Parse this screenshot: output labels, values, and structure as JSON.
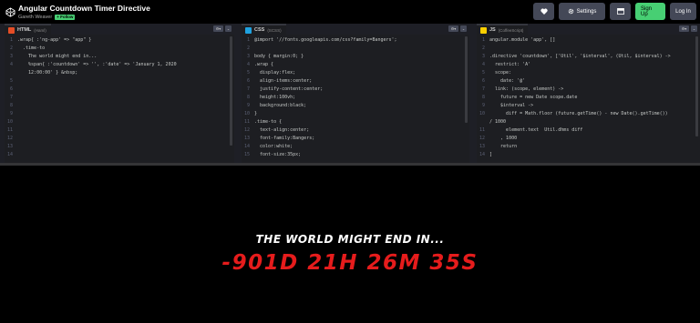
{
  "header": {
    "pen_title": "Angular Countdown Timer Directive",
    "author": "Gareth Weaver",
    "follow_label": "+ Follow",
    "settings_label": "Settings",
    "signup_label": "Sign Up",
    "login_label": "Log In",
    "icons": {
      "heart": "heart-icon",
      "settings": "gear-icon",
      "layout": "layout-icon"
    }
  },
  "editors": {
    "html": {
      "name": "HTML",
      "preprocessor": "(Haml)",
      "icon_color": "#e54d26",
      "lines": [
        {
          "n": "1",
          "text": ".wrap{ :'ng-app' => \"app\" }"
        },
        {
          "n": "2",
          "text": "  .time-to"
        },
        {
          "n": "3",
          "text": "    The world might end in..."
        },
        {
          "n": "4",
          "text": "    %span{ :'countdown' => '', :'date' => 'January 1, 2020"
        },
        {
          "n": "",
          "text": "    12:00:00' } &nbsp;"
        },
        {
          "n": "5",
          "text": ""
        },
        {
          "n": "6",
          "text": ""
        },
        {
          "n": "7",
          "text": ""
        },
        {
          "n": "8",
          "text": ""
        },
        {
          "n": "9",
          "text": ""
        },
        {
          "n": "10",
          "text": ""
        },
        {
          "n": "11",
          "text": ""
        },
        {
          "n": "12",
          "text": ""
        },
        {
          "n": "13",
          "text": ""
        },
        {
          "n": "14",
          "text": ""
        }
      ]
    },
    "css": {
      "name": "CSS",
      "preprocessor": "(SCSS)",
      "icon_color": "#1fa2e0",
      "lines": [
        {
          "n": "1",
          "text": "@import '//fonts.googleapis.com/css?family=Bangers';"
        },
        {
          "n": "2",
          "text": ""
        },
        {
          "n": "3",
          "text": "body { margin:0; }"
        },
        {
          "n": "4",
          "text": ".wrap {"
        },
        {
          "n": "5",
          "text": "  display:flex;"
        },
        {
          "n": "6",
          "text": "  align-items:center;"
        },
        {
          "n": "7",
          "text": "  justify-content:center;"
        },
        {
          "n": "8",
          "text": "  height:100vh;"
        },
        {
          "n": "9",
          "text": "  background:black;"
        },
        {
          "n": "10",
          "text": "}"
        },
        {
          "n": "11",
          "text": ".time-to {"
        },
        {
          "n": "12",
          "text": "  text-align:center;"
        },
        {
          "n": "13",
          "text": "  font-family:Bangers;"
        },
        {
          "n": "14",
          "text": "  color:white;"
        },
        {
          "n": "15",
          "text": "  font-size:35px;"
        }
      ]
    },
    "js": {
      "name": "JS",
      "preprocessor": "(CoffeeScript)",
      "icon_color": "#fcd000",
      "lines": [
        {
          "n": "1",
          "text": "angular.module 'app', []"
        },
        {
          "n": "2",
          "text": ""
        },
        {
          "n": "3",
          "text": ".directive 'countdown', ['Util', '$interval', (Util, $interval) ->"
        },
        {
          "n": "4",
          "text": "  restrict: 'A'"
        },
        {
          "n": "5",
          "text": "  scope:"
        },
        {
          "n": "6",
          "text": "    date: '@'"
        },
        {
          "n": "7",
          "text": "  link: (scope, element) ->"
        },
        {
          "n": "8",
          "text": "    future = new Date scope.date"
        },
        {
          "n": "9",
          "text": "    $interval ->"
        },
        {
          "n": "10",
          "text": "      diff = Math.floor (future.getTime() - new Date().getTime())"
        },
        {
          "n": "",
          "text": "/ 1000"
        },
        {
          "n": "11",
          "text": "      element.text  Util.dhms diff"
        },
        {
          "n": "12",
          "text": "    , 1000"
        },
        {
          "n": "13",
          "text": "    return"
        },
        {
          "n": "14",
          "text": "]"
        }
      ]
    }
  },
  "preview": {
    "subtitle": "THE WORLD MIGHT END IN...",
    "countdown": "-901D 21H 26M 35S"
  }
}
